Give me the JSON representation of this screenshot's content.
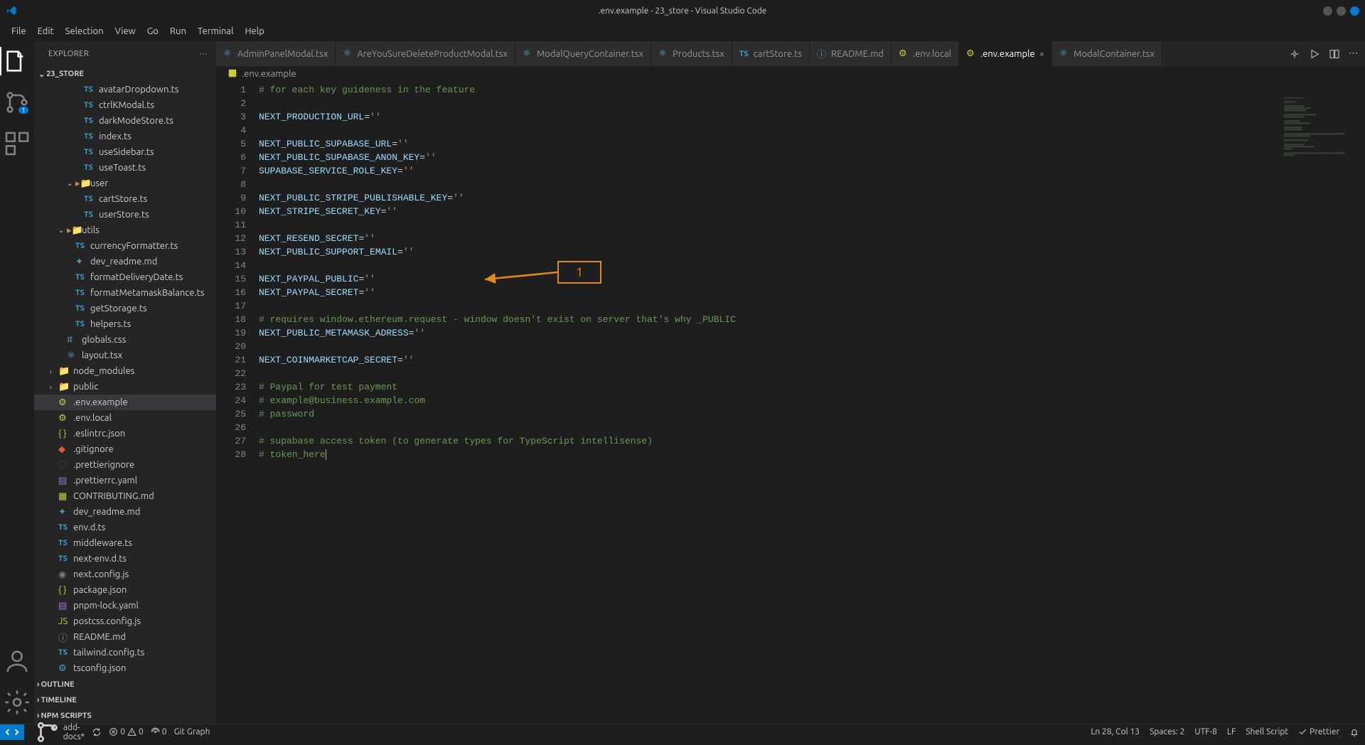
{
  "window": {
    "title": ".env.example - 23_store - Visual Studio Code"
  },
  "menu": [
    "File",
    "Edit",
    "Selection",
    "View",
    "Go",
    "Run",
    "Terminal",
    "Help"
  ],
  "activity": {
    "badge_scm": "1"
  },
  "sidebar": {
    "title": "EXPLORER",
    "project": "23_STORE",
    "sections": {
      "outline": "OUTLINE",
      "timeline": "TIMELINE",
      "npm": "NPM SCRIPTS"
    },
    "files": [
      {
        "depth": 3,
        "name": "avatarDropdown.ts",
        "icon": "ts"
      },
      {
        "depth": 3,
        "name": "ctrlKModal.ts",
        "icon": "ts"
      },
      {
        "depth": 3,
        "name": "darkModeStore.ts",
        "icon": "ts"
      },
      {
        "depth": 3,
        "name": "index.ts",
        "icon": "ts"
      },
      {
        "depth": 3,
        "name": "useSidebar.ts",
        "icon": "ts"
      },
      {
        "depth": 3,
        "name": "useToast.ts",
        "icon": "ts"
      },
      {
        "depth": 2,
        "name": "user",
        "icon": "folder",
        "chev": "v"
      },
      {
        "depth": 3,
        "name": "cartStore.ts",
        "icon": "ts"
      },
      {
        "depth": 3,
        "name": "userStore.ts",
        "icon": "ts"
      },
      {
        "depth": 1,
        "name": "utils",
        "icon": "folder",
        "chev": "v"
      },
      {
        "depth": 2,
        "name": "currencyFormatter.ts",
        "icon": "ts"
      },
      {
        "depth": 2,
        "name": "dev_readme.md",
        "icon": "md"
      },
      {
        "depth": 2,
        "name": "formatDeliveryDate.ts",
        "icon": "ts"
      },
      {
        "depth": 2,
        "name": "formatMetamaskBalance.ts",
        "icon": "ts"
      },
      {
        "depth": 2,
        "name": "getStorage.ts",
        "icon": "ts"
      },
      {
        "depth": 2,
        "name": "helpers.ts",
        "icon": "ts"
      },
      {
        "depth": 1,
        "name": "globals.css",
        "icon": "css"
      },
      {
        "depth": 1,
        "name": "layout.tsx",
        "icon": "react"
      },
      {
        "depth": 0,
        "name": "node_modules",
        "icon": "folder-green",
        "chev": ">"
      },
      {
        "depth": 0,
        "name": "public",
        "icon": "folder-green",
        "chev": ">"
      },
      {
        "depth": 0,
        "name": ".env.example",
        "icon": "env",
        "selected": true
      },
      {
        "depth": 0,
        "name": ".env.local",
        "icon": "env"
      },
      {
        "depth": 0,
        "name": ".eslintrc.json",
        "icon": "json"
      },
      {
        "depth": 0,
        "name": ".gitignore",
        "icon": "git"
      },
      {
        "depth": 0,
        "name": ".prettierignore",
        "icon": "hidden"
      },
      {
        "depth": 0,
        "name": ".prettierrc.yaml",
        "icon": "yaml"
      },
      {
        "depth": 0,
        "name": "CONTRIBUTING.md",
        "icon": "contrib"
      },
      {
        "depth": 0,
        "name": "dev_readme.md",
        "icon": "md"
      },
      {
        "depth": 0,
        "name": "env.d.ts",
        "icon": "ts"
      },
      {
        "depth": 0,
        "name": "middleware.ts",
        "icon": "ts"
      },
      {
        "depth": 0,
        "name": "next-env.d.ts",
        "icon": "ts"
      },
      {
        "depth": 0,
        "name": "next.config.js",
        "icon": "js-dark"
      },
      {
        "depth": 0,
        "name": "package.json",
        "icon": "json"
      },
      {
        "depth": 0,
        "name": "pnpm-lock.yaml",
        "icon": "yaml"
      },
      {
        "depth": 0,
        "name": "postcss.config.js",
        "icon": "js"
      },
      {
        "depth": 0,
        "name": "README.md",
        "icon": "readme"
      },
      {
        "depth": 0,
        "name": "tailwind.config.ts",
        "icon": "ts"
      },
      {
        "depth": 0,
        "name": "tsconfig.json",
        "icon": "ts-json"
      }
    ]
  },
  "tabs": [
    {
      "label": "AdminPanelModal.tsx",
      "icon": "react"
    },
    {
      "label": "AreYouSureDeleteProductModal.tsx",
      "icon": "react"
    },
    {
      "label": "ModalQueryContainer.tsx",
      "icon": "react"
    },
    {
      "label": "Products.tsx",
      "icon": "react"
    },
    {
      "label": "cartStore.ts",
      "icon": "ts"
    },
    {
      "label": "README.md",
      "icon": "readme"
    },
    {
      "label": ".env.local",
      "icon": "env"
    },
    {
      "label": ".env.example",
      "icon": "env",
      "active": true
    },
    {
      "label": "ModalContainer.tsx",
      "icon": "react"
    }
  ],
  "breadcrumb": {
    "icon": "env",
    "label": ".env.example"
  },
  "editor": {
    "lines": [
      {
        "n": 1,
        "t": "comment",
        "text": "# for each key guideness in the feature"
      },
      {
        "n": 2,
        "t": "blank",
        "text": ""
      },
      {
        "n": 3,
        "t": "kv",
        "k": "NEXT_PRODUCTION_URL",
        "v": "''"
      },
      {
        "n": 4,
        "t": "blank",
        "text": ""
      },
      {
        "n": 5,
        "t": "kv",
        "k": "NEXT_PUBLIC_SUPABASE_URL",
        "v": "''"
      },
      {
        "n": 6,
        "t": "kv",
        "k": "NEXT_PUBLIC_SUPABASE_ANON_KEY",
        "v": "''"
      },
      {
        "n": 7,
        "t": "kv",
        "k": "SUPABASE_SERVICE_ROLE_KEY",
        "v": "''"
      },
      {
        "n": 8,
        "t": "blank",
        "text": ""
      },
      {
        "n": 9,
        "t": "kv",
        "k": "NEXT_PUBLIC_STRIPE_PUBLISHABLE_KEY",
        "v": "''"
      },
      {
        "n": 10,
        "t": "kv",
        "k": "NEXT_STRIPE_SECRET_KEY",
        "v": "''"
      },
      {
        "n": 11,
        "t": "blank",
        "text": ""
      },
      {
        "n": 12,
        "t": "kv",
        "k": "NEXT_RESEND_SECRET",
        "v": "''"
      },
      {
        "n": 13,
        "t": "kv",
        "k": "NEXT_PUBLIC_SUPPORT_EMAIL",
        "v": "''"
      },
      {
        "n": 14,
        "t": "blank",
        "text": ""
      },
      {
        "n": 15,
        "t": "kv",
        "k": "NEXT_PAYPAL_PUBLIC",
        "v": "''"
      },
      {
        "n": 16,
        "t": "kv",
        "k": "NEXT_PAYPAL_SECRET",
        "v": "''"
      },
      {
        "n": 17,
        "t": "blank",
        "text": ""
      },
      {
        "n": 18,
        "t": "comment",
        "text": "# requires window.ethereum.request - window doesn't exist on server that's why _PUBLIC"
      },
      {
        "n": 19,
        "t": "kv",
        "k": "NEXT_PUBLIC_METAMASK_ADRESS",
        "v": "''"
      },
      {
        "n": 20,
        "t": "blank",
        "text": ""
      },
      {
        "n": 21,
        "t": "kv",
        "k": "NEXT_COINMARKETCAP_SECRET",
        "v": "''"
      },
      {
        "n": 22,
        "t": "blank",
        "text": ""
      },
      {
        "n": 23,
        "t": "comment",
        "text": "# Paypal for test payment"
      },
      {
        "n": 24,
        "t": "comment",
        "text": "# example@business.example.com"
      },
      {
        "n": 25,
        "t": "comment",
        "text": "# password"
      },
      {
        "n": 26,
        "t": "blank",
        "text": ""
      },
      {
        "n": 27,
        "t": "comment",
        "text": "# supabase access token (to generate types for TypeScript intellisense)"
      },
      {
        "n": 28,
        "t": "comment-cursor",
        "text": "# token_here"
      }
    ]
  },
  "annotation": {
    "label": "1"
  },
  "status": {
    "branch": "add-docs*",
    "sync": "",
    "errors": "0",
    "warnings": "0",
    "radio": "0",
    "gitgraph": "Git Graph",
    "position": "Ln 28, Col 13",
    "spaces": "Spaces: 2",
    "encoding": "UTF-8",
    "eol": "LF",
    "lang": "Shell Script",
    "prettier": "Prettier"
  }
}
